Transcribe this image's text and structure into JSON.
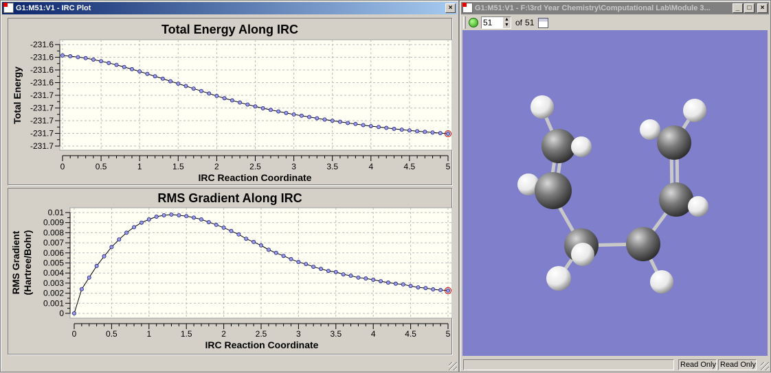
{
  "irc_window": {
    "title": "G1:M51:V1 - IRC Plot",
    "close_label": "×"
  },
  "viewer_window": {
    "title": "G1:M51:V1 - F:\\3rd Year Chemistry\\Computational Lab\\Module 3...",
    "minimize_label": "_",
    "maximize_label": "□",
    "close_label": "×",
    "frame_value": "51",
    "of_label": "of",
    "frame_total": "51",
    "status": [
      "",
      "Read Only",
      "Read Only"
    ],
    "background_color": "#7f7fcc"
  },
  "chart_data": [
    {
      "type": "line",
      "title": "Total Energy Along IRC",
      "xlabel": "IRC Reaction Coordinate",
      "ylabel": "Total Energy",
      "xlim": [
        0,
        5
      ],
      "ylim": [
        -231.68,
        -231.6
      ],
      "x_ticks": [
        "0",
        "0.5",
        "1",
        "1.5",
        "2",
        "2.5",
        "3",
        "3.5",
        "4",
        "4.5",
        "5"
      ],
      "y_ticks": [
        "-231.6",
        "-231.6",
        "-231.6",
        "-231.6",
        "-231.7",
        "-231.7",
        "-231.7",
        "-231.7",
        "-231.7"
      ],
      "grid": true,
      "x_step": 0.1,
      "values": [
        -231.6086,
        -231.6092,
        -231.6099,
        -231.6107,
        -231.6118,
        -231.6131,
        -231.6145,
        -231.616,
        -231.6177,
        -231.6194,
        -231.6212,
        -231.6231,
        -231.625,
        -231.6269,
        -231.6289,
        -231.6308,
        -231.6327,
        -231.6347,
        -231.6366,
        -231.6386,
        -231.6405,
        -231.6423,
        -231.644,
        -231.6457,
        -231.6473,
        -231.6488,
        -231.6502,
        -231.6515,
        -231.6527,
        -231.6539,
        -231.6551,
        -231.6561,
        -231.6571,
        -231.6581,
        -231.6591,
        -231.66,
        -231.6609,
        -231.6618,
        -231.6626,
        -231.6635,
        -231.6643,
        -231.665,
        -231.6657,
        -231.6664,
        -231.6671,
        -231.6677,
        -231.6683,
        -231.6688,
        -231.6693,
        -231.6698,
        -231.6703
      ],
      "highlighted_index": 50,
      "marker_color": "#9999e6",
      "highlight_color": "#cc0000"
    },
    {
      "type": "line",
      "title": "RMS Gradient Along IRC",
      "xlabel": "IRC Reaction Coordinate",
      "ylabel": [
        "RMS Gradient",
        "(Hartree/Bohr)"
      ],
      "xlim": [
        0,
        5
      ],
      "ylim": [
        0,
        0.01
      ],
      "x_ticks": [
        "0",
        "0.5",
        "1",
        "1.5",
        "2",
        "2.5",
        "3",
        "3.5",
        "4",
        "4.5",
        "5"
      ],
      "y_ticks": [
        "0.01",
        "0.009",
        "0.008",
        "0.007",
        "0.006",
        "0.005",
        "0.004",
        "0.003",
        "0.002",
        "0.001",
        "0"
      ],
      "grid": true,
      "x_step": 0.1,
      "values": [
        0,
        0.0024,
        0.00355,
        0.0047,
        0.00566,
        0.00658,
        0.00733,
        0.008,
        0.00855,
        0.009,
        0.00932,
        0.00959,
        0.00973,
        0.0098,
        0.00973,
        0.00964,
        0.0095,
        0.00932,
        0.00905,
        0.00878,
        0.0085,
        0.00817,
        0.00783,
        0.0074,
        0.00708,
        0.00674,
        0.00631,
        0.006,
        0.0057,
        0.00538,
        0.00509,
        0.00489,
        0.00462,
        0.00441,
        0.00421,
        0.0041,
        0.00387,
        0.00373,
        0.00355,
        0.00346,
        0.00333,
        0.00319,
        0.00305,
        0.00294,
        0.00287,
        0.00271,
        0.00258,
        0.00251,
        0.00238,
        0.00231,
        0.00226
      ],
      "highlighted_index": 50,
      "marker_color": "#9999e6",
      "highlight_color": "#cc0000"
    }
  ]
}
